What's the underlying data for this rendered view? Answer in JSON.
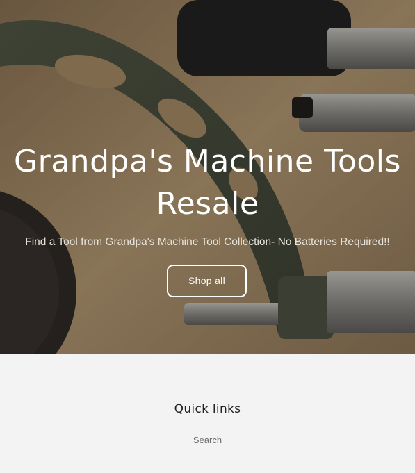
{
  "hero": {
    "title": "Grandpa's Machine Tools Resale",
    "subtitle": "Find a Tool from Grandpa's Machine Tool Collection- No Batteries Required!!",
    "cta_label": "Shop all"
  },
  "footer": {
    "heading": "Quick links",
    "links": [
      "Search"
    ]
  },
  "colors": {
    "footer_bg": "#f3f3f3",
    "hero_text": "#ffffff"
  }
}
